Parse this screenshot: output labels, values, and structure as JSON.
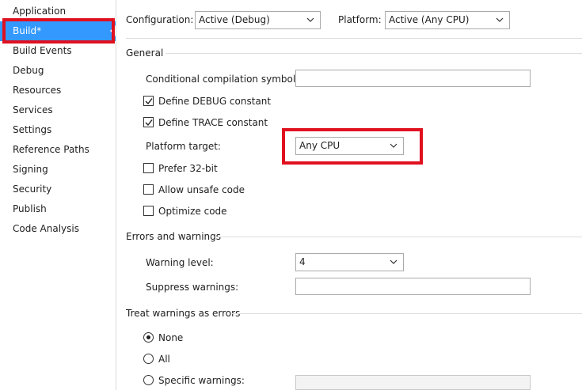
{
  "sidebar": {
    "items": [
      {
        "label": "Application"
      },
      {
        "label": "Build*"
      },
      {
        "label": "Build Events"
      },
      {
        "label": "Debug"
      },
      {
        "label": "Resources"
      },
      {
        "label": "Services"
      },
      {
        "label": "Settings"
      },
      {
        "label": "Reference Paths"
      },
      {
        "label": "Signing"
      },
      {
        "label": "Security"
      },
      {
        "label": "Publish"
      },
      {
        "label": "Code Analysis"
      }
    ],
    "active_index": 1
  },
  "toolbar": {
    "configuration_label": "Configuration:",
    "configuration_value": "Active (Debug)",
    "platform_label": "Platform:",
    "platform_value": "Active (Any CPU)"
  },
  "general": {
    "title": "General",
    "conditional_symbols_label": "Conditional compilation symbols:",
    "conditional_symbols_value": "",
    "define_debug": {
      "label": "Define DEBUG constant",
      "checked": true
    },
    "define_trace": {
      "label": "Define TRACE constant",
      "checked": true
    },
    "platform_target_label": "Platform target:",
    "platform_target_value": "Any CPU",
    "prefer_32bit": {
      "label": "Prefer 32-bit",
      "checked": false
    },
    "allow_unsafe": {
      "label": "Allow unsafe code",
      "checked": false
    },
    "optimize": {
      "label": "Optimize code",
      "checked": false
    }
  },
  "errors_warnings": {
    "title": "Errors and warnings",
    "warning_level_label": "Warning level:",
    "warning_level_value": "4",
    "suppress_label": "Suppress warnings:",
    "suppress_value": ""
  },
  "treat_warnings": {
    "title": "Treat warnings as errors",
    "options": [
      {
        "label": "None",
        "selected": true
      },
      {
        "label": "All",
        "selected": false
      },
      {
        "label": "Specific warnings:",
        "selected": false
      }
    ],
    "specific_value": ""
  },
  "colors": {
    "accent": "#3399ff",
    "highlight": "#e0101f"
  }
}
